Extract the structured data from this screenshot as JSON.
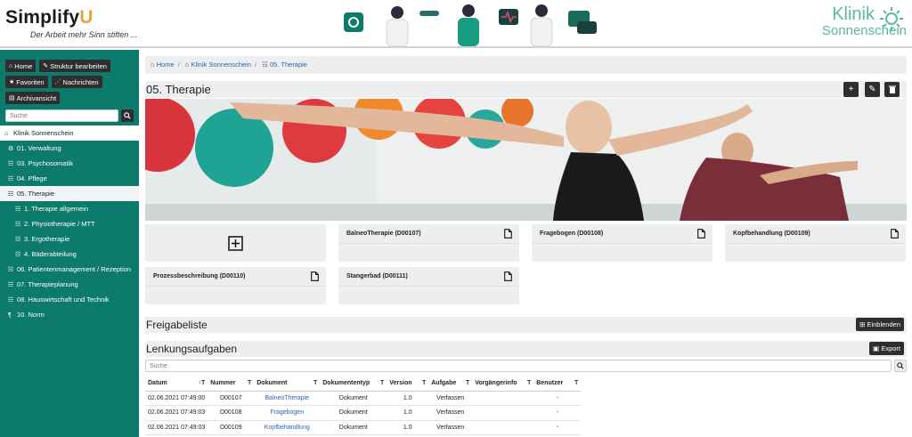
{
  "header": {
    "brand_main": "Simplify",
    "brand_u": "U",
    "brand_tagline": "Der Arbeit mehr Sinn stiften ...",
    "clinic_line1": "Klinik",
    "clinic_line2": "Sonnenschein"
  },
  "sidebar": {
    "buttons": [
      {
        "label": "Home",
        "icon": "home-icon"
      },
      {
        "label": "Struktur bearbeiten",
        "icon": "pencil-icon"
      },
      {
        "label": "Favoriten",
        "icon": "star-icon"
      },
      {
        "label": "Nachrichten",
        "icon": "rss-icon"
      },
      {
        "label": "Archivansicht",
        "icon": "archive-icon"
      }
    ],
    "search_placeholder": "Suche",
    "items": [
      {
        "label": "Klinik Sonnenschein"
      },
      {
        "label": "01. Verwaltung"
      },
      {
        "label": "03. Psychosomatik"
      },
      {
        "label": "04. Pflege"
      },
      {
        "label": "05. Therapie"
      },
      {
        "label": "1. Therapie allgemein"
      },
      {
        "label": "2. Physiotherapie / MTT"
      },
      {
        "label": "3. Ergotherapie"
      },
      {
        "label": "4. Bäderabteilung"
      },
      {
        "label": "06. Patientenmanagement / Rezeption"
      },
      {
        "label": "07. Therapieplanung"
      },
      {
        "label": "08. Hauswirtschaft und Technik"
      },
      {
        "label": "10. Norm"
      }
    ]
  },
  "breadcrumb": {
    "home": "Home",
    "clinic": "Klinik Sonnenschein",
    "current": "05. Therapie"
  },
  "page": {
    "title": "05. Therapie"
  },
  "documents": [
    {
      "title": "BalneoTherapie (D00107)"
    },
    {
      "title": "Fragebogen (D00108)"
    },
    {
      "title": "Kopfbehandlung (D00109)"
    },
    {
      "title": "Prozessbeschreibung (D00110)"
    },
    {
      "title": "Stangerbad (D00111)"
    }
  ],
  "freigabe": {
    "title": "Freigabeliste",
    "button": "Einblenden"
  },
  "lenkung": {
    "title": "Lenkungsaufgaben",
    "button": "Export",
    "search_placeholder": "Suche",
    "columns": [
      "Datum",
      "Nummer",
      "Dokument",
      "Dokumententyp",
      "Version",
      "Aufgabe",
      "Vorgängerinfo",
      "Benutzer"
    ],
    "rows": [
      {
        "datum": "02.06.2021 07:49:00",
        "nummer": "D00107",
        "dokument": "BalneoTherapie",
        "typ": "Dokument",
        "version": "1.0",
        "aufgabe": "Verfassen",
        "vorgaenger": "",
        "benutzer": "-"
      },
      {
        "datum": "02.06.2021 07:49:03",
        "nummer": "D00108",
        "dokument": "Fragebogen",
        "typ": "Dokument",
        "version": "1.0",
        "aufgabe": "Verfassen",
        "vorgaenger": "",
        "benutzer": "-"
      },
      {
        "datum": "02.06.2021 07:49:03",
        "nummer": "D00109",
        "dokument": "Kopfbehandlung",
        "typ": "Dokument",
        "version": "1.0",
        "aufgabe": "Verfassen",
        "vorgaenger": "",
        "benutzer": "-"
      }
    ]
  },
  "colors": {
    "sidebar": "#0c7b6c",
    "accent": "#5bb89a",
    "brand_u": "#e8a33b",
    "link": "#2a64b5",
    "button_dark": "#2e2e2e"
  }
}
